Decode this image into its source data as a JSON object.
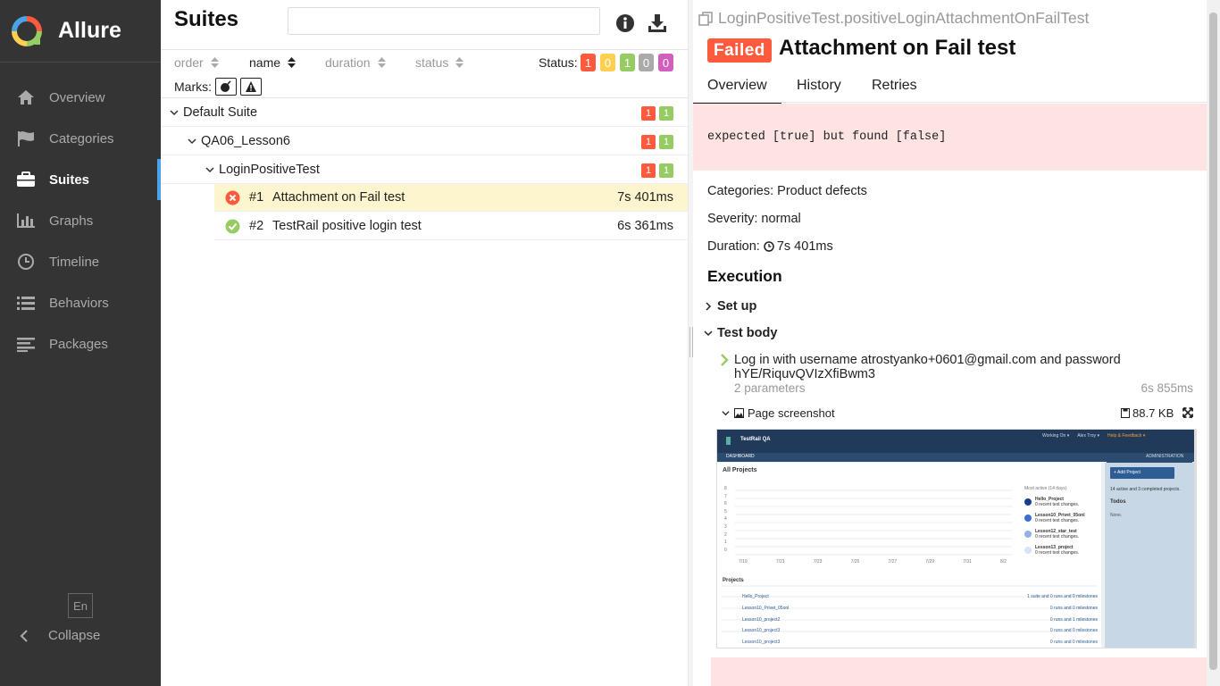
{
  "app": {
    "name": "Allure",
    "lang": "En",
    "collapse_label": "Collapse"
  },
  "sidebar": {
    "items": [
      {
        "label": "Overview",
        "icon": "home-icon"
      },
      {
        "label": "Categories",
        "icon": "flag-icon"
      },
      {
        "label": "Suites",
        "icon": "briefcase-icon",
        "active": true
      },
      {
        "label": "Graphs",
        "icon": "bar-chart-icon"
      },
      {
        "label": "Timeline",
        "icon": "clock-icon"
      },
      {
        "label": "Behaviors",
        "icon": "list-icon"
      },
      {
        "label": "Packages",
        "icon": "align-left-icon"
      }
    ]
  },
  "suites": {
    "title": "Suites",
    "search_value": "",
    "sort": {
      "order": "order",
      "name": "name",
      "duration": "duration",
      "status": "status"
    },
    "status_label": "Status:",
    "status_counts": [
      {
        "value": "1",
        "color": "#fd5a3e"
      },
      {
        "value": "0",
        "color": "#ffd050"
      },
      {
        "value": "1",
        "color": "#97cc64"
      },
      {
        "value": "0",
        "color": "#aaaaaa"
      },
      {
        "value": "0",
        "color": "#d35ebe"
      }
    ],
    "marks_label": "Marks:",
    "tree": {
      "suite": {
        "label": "Default Suite",
        "failed": "1",
        "passed": "1"
      },
      "group": {
        "label": "QA06_Lesson6",
        "failed": "1",
        "passed": "1"
      },
      "class": {
        "label": "LoginPositiveTest",
        "failed": "1",
        "passed": "1"
      },
      "tests": [
        {
          "num": "#1",
          "name": "Attachment on Fail test",
          "duration": "7s 401ms",
          "status": "failed"
        },
        {
          "num": "#2",
          "name": "TestRail positive login test",
          "duration": "6s 361ms",
          "status": "passed"
        }
      ]
    }
  },
  "detail": {
    "fullname": "LoginPositiveTest.positiveLoginAttachmentOnFailTest",
    "status_badge": "Failed",
    "title": "Attachment on Fail test",
    "tabs": [
      "Overview",
      "History",
      "Retries"
    ],
    "error": "expected [true] but found [false]",
    "categories": "Categories: Product defects",
    "severity": "Severity: normal",
    "duration_label": "Duration:",
    "duration": "7s 401ms",
    "execution_title": "Execution",
    "setup_label": "Set up",
    "body_label": "Test body",
    "step": {
      "text": "Log in with username atrostyanko+0601@gmail.com and password hYE/RiquvQVIzXfiBwm3",
      "params": "2 parameters",
      "duration": "6s 855ms"
    },
    "attachment": {
      "name": "Page screenshot",
      "size": "88.7 KB"
    }
  },
  "screenshot": {
    "app_title": "TestRail QA",
    "top_menu": [
      "Working On ▾",
      "Alex Troy ▾",
      "Help & Feedback ▾"
    ],
    "tabs": [
      "DASHBOARD",
      "ADMINISTRATION"
    ],
    "all_projects": "All Projects",
    "add_project": "+ Add Project",
    "summary": "14 active and 3 completed projects.",
    "todos": "Todos",
    "none": "None.",
    "most_active": "Most active (14 days)",
    "legend": [
      {
        "name": "Hello_Project",
        "sub": "0 recent test changes.",
        "color": "#1a3e8c"
      },
      {
        "name": "Lesson10_Privet_05onl",
        "sub": "0 recent test changes.",
        "color": "#3d6fd1"
      },
      {
        "name": "Lesson12_star_test",
        "sub": "0 recent test changes.",
        "color": "#8fb0e8"
      },
      {
        "name": "Lesson13_project",
        "sub": "0 recent test changes.",
        "color": "#d7e3f7"
      }
    ],
    "y_ticks": [
      "8",
      "7",
      "6",
      "5",
      "4",
      "3",
      "2",
      "1",
      "0"
    ],
    "x_ticks": [
      "7/19",
      "7/21",
      "7/23",
      "7/25",
      "7/27",
      "7/29",
      "7/31",
      "8/2"
    ],
    "projects_label": "Projects",
    "projects": [
      {
        "name": "Hello_Project",
        "info": "1 suite and 0 runs and 0 milestones"
      },
      {
        "name": "Lesson10_Privet_05onl",
        "info": "0 runs and 0 milestones"
      },
      {
        "name": "Lesson10_project2",
        "info": "0 runs and 1 milestones"
      },
      {
        "name": "Lesson10_project3",
        "info": "0 runs and 0 milestones"
      },
      {
        "name": "Lesson10_project3",
        "info": "0 runs and 0 milestones"
      }
    ]
  }
}
